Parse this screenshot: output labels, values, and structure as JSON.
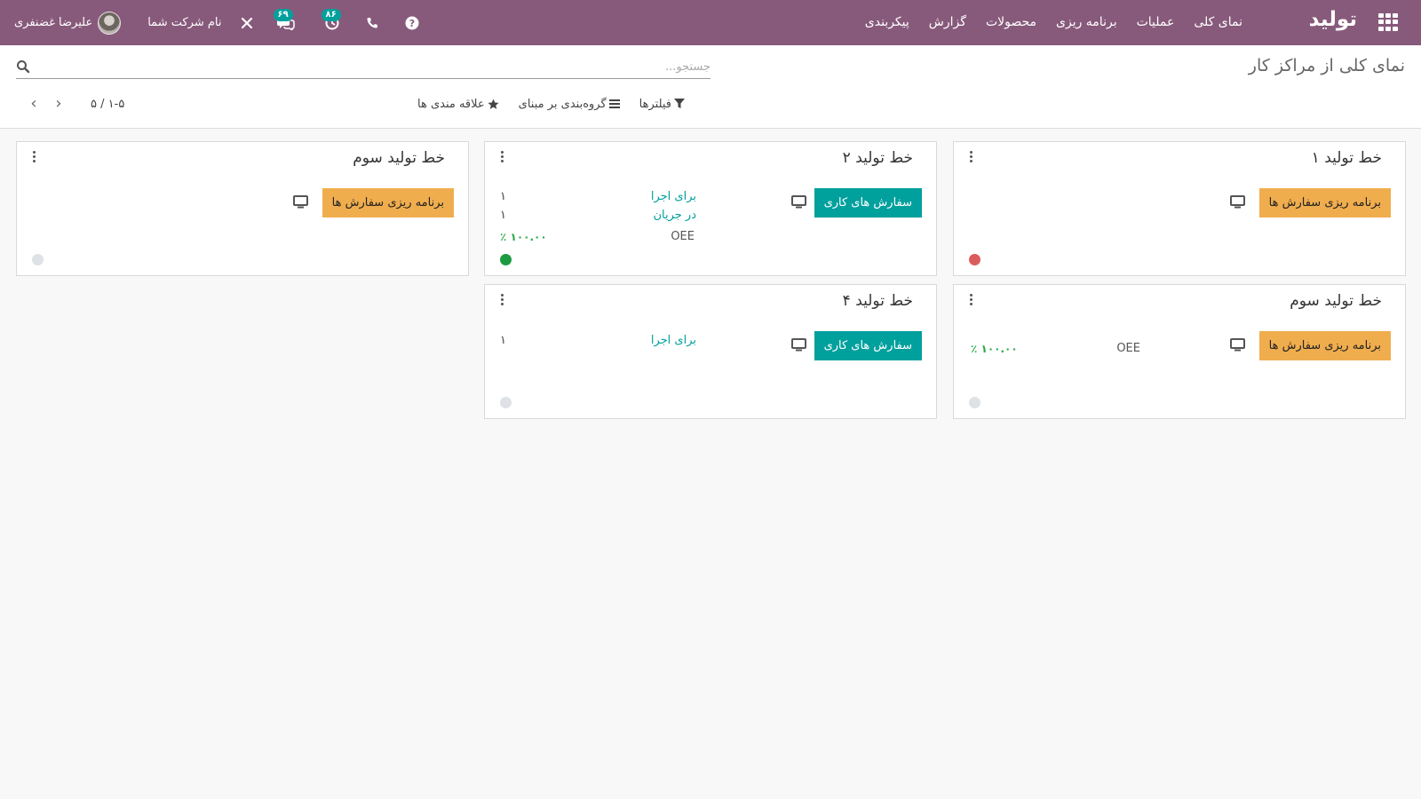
{
  "app": {
    "title": "تولید",
    "menu": [
      "نمای کلی",
      "عملیات",
      "برنامه ریزی",
      "محصولات",
      "گزارش",
      "پیکربندی"
    ]
  },
  "systray": {
    "user_name": "علیرضا غضنفری",
    "company": "نام شرکت شما",
    "messages_count": "۶۹",
    "activities_count": "۸۶"
  },
  "page": {
    "title": "نمای کلی از مراکز کار",
    "search_placeholder": "جستجو...",
    "filters_label": "فیلترها",
    "groupby_label": "گروه‌بندی بر مبنای",
    "favorites_label": "علاقه مندی ها",
    "pager_value": "۱-۵ / ۵"
  },
  "cards": [
    {
      "title": "خط تولید ۱",
      "button": "برنامه ریزی سفارش ها",
      "status_color": "#dc5c5c"
    },
    {
      "title": "خط تولید ۲",
      "button": "سفارش های کاری",
      "ready_label": "برای اجرا",
      "ready_value": "۱",
      "progress_label": "در جریان",
      "progress_value": "۱",
      "oee_label": "OEE",
      "oee_value": "۱۰۰.۰۰ ٪",
      "status_color": "#1e9b40"
    },
    {
      "title": "خط تولید سوم",
      "button": "برنامه ریزی سفارش ها",
      "status_color": "#dee2e6"
    },
    {
      "title": "خط تولید سوم",
      "button": "برنامه ریزی سفارش ها",
      "oee_label": "OEE",
      "oee_value": "۱۰۰.۰۰ ٪",
      "status_color": "#dee2e6"
    },
    {
      "title": "خط تولید ۴",
      "button": "سفارش های کاری",
      "ready_label": "برای اجرا",
      "ready_value": "۱",
      "status_color": "#dee2e6"
    }
  ],
  "colors": {
    "brand": "#875a7b",
    "primary": "#00a09d",
    "warning": "#f0ad4e"
  }
}
